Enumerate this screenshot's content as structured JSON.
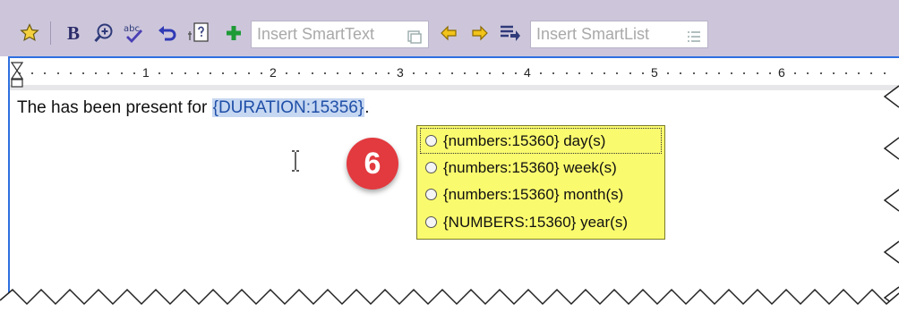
{
  "toolbar": {
    "icons": [
      "star-icon",
      "bold-icon",
      "zoom-in-icon",
      "spellcheck-icon",
      "undo-icon",
      "smartphrase-icon",
      "add-icon",
      "arrow-left-icon",
      "arrow-right-icon",
      "list-arrow-icon"
    ],
    "bold_label": "B",
    "smarttext_placeholder": "Insert SmartText",
    "smartlist_placeholder": "Insert SmartList",
    "colors": {
      "toolbar_bg": "#cdc6db",
      "accent_border": "#2f6fe0"
    }
  },
  "ruler": {
    "numbers": [
      "1",
      "2",
      "3",
      "4",
      "5",
      "6"
    ]
  },
  "document": {
    "text_before": "The has been present for ",
    "smartlink": "{DURATION:15356}",
    "text_after": "."
  },
  "badge": {
    "number": "6",
    "color": "#e23a3f"
  },
  "popup": {
    "options": [
      "{numbers:15360} day(s)",
      "{numbers:15360} week(s)",
      "{numbers:15360} month(s)",
      "{NUMBERS:15360} year(s)"
    ],
    "background": "#fafa6e"
  }
}
